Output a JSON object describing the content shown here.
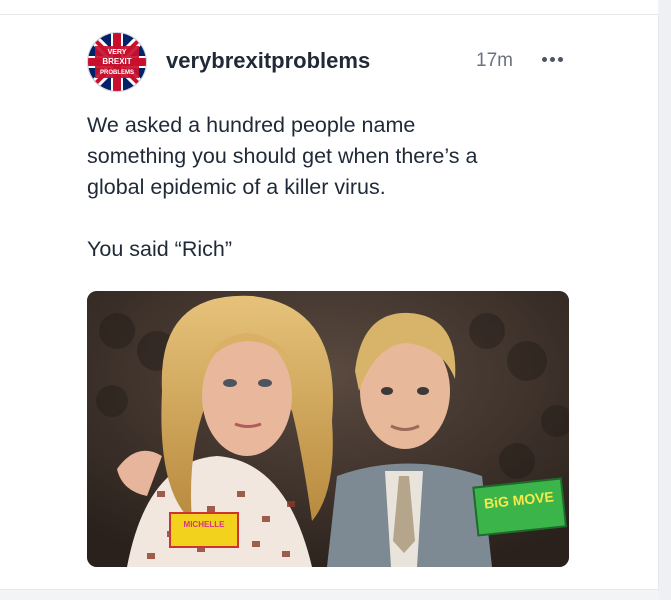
{
  "post": {
    "username": "verybrexitproblems",
    "timestamp": "17m",
    "text_lines": [
      "We asked a hundred people name",
      "something you should get when there’s a",
      "global epidemic of a killer virus."
    ],
    "text_line2": "You said “Rich”",
    "avatar_text": [
      "VERY",
      "BREXIT",
      "PROBLEMS"
    ],
    "image": {
      "badge_left": "MICHELLE",
      "badge_right": "BiG MOVE"
    }
  },
  "icons": {
    "more": "more-horizontal-icon",
    "avatar": "union-jack-avatar"
  },
  "colors": {
    "text": "#1f2937",
    "muted": "#6b7280",
    "avatar_red": "#c8102e",
    "avatar_blue": "#012169"
  }
}
